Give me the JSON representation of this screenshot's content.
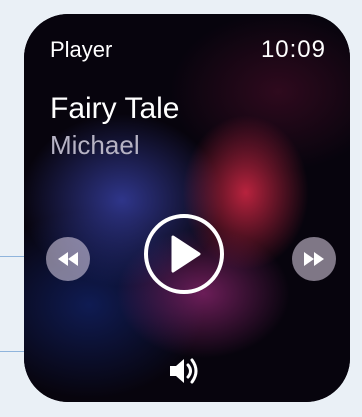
{
  "app": {
    "title": "Player",
    "time": "10:09"
  },
  "track": {
    "title": "Fairy Tale",
    "artist": "Michael"
  },
  "controls": {
    "rewind_icon": "rewind-icon",
    "play_icon": "play-icon",
    "fast_forward_icon": "fast-forward-icon",
    "volume_icon": "volume-icon"
  },
  "colors": {
    "watch_body": "#050208",
    "accent_red": "#d72846",
    "accent_blue": "#3c46b4",
    "text_primary": "#ffffff",
    "text_secondary": "#b6b3c4"
  }
}
